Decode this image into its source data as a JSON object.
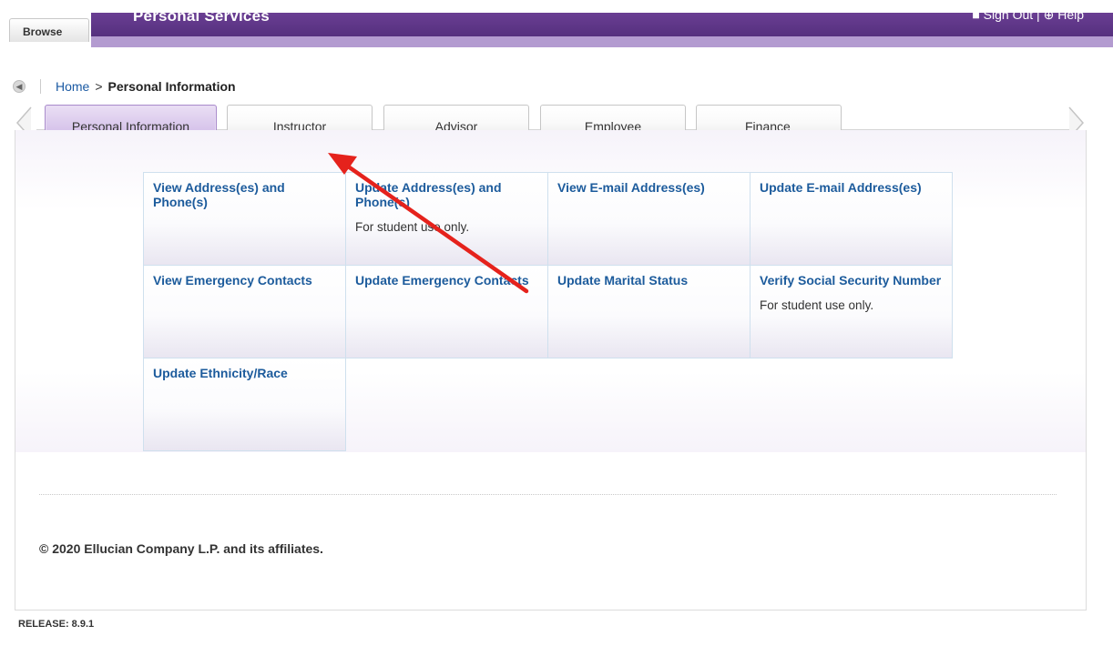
{
  "header": {
    "title": "Personal Services",
    "browse_label": "Browse",
    "sign_out_label": "Sign Out",
    "help_label": "Help",
    "divider": "|"
  },
  "breadcrumb": {
    "home": "Home",
    "separator": ">",
    "current": "Personal Information"
  },
  "tabs": [
    {
      "label": "Personal Information",
      "active": true
    },
    {
      "label": "Instructor",
      "active": false
    },
    {
      "label": "Advisor",
      "active": false
    },
    {
      "label": "Employee",
      "active": false
    },
    {
      "label": "Finance",
      "active": false
    }
  ],
  "menu": [
    {
      "label": "View Address(es) and Phone(s)",
      "note": ""
    },
    {
      "label": "Update Address(es) and Phone(s)",
      "note": "For student use only."
    },
    {
      "label": "View E-mail Address(es)",
      "note": ""
    },
    {
      "label": "Update E-mail Address(es)",
      "note": ""
    },
    {
      "label": "View Emergency Contacts",
      "note": ""
    },
    {
      "label": "Update Emergency Contacts",
      "note": ""
    },
    {
      "label": "Update Marital Status",
      "note": ""
    },
    {
      "label": "Verify Social Security Number",
      "note": "For student use only."
    },
    {
      "label": "Update Ethnicity/Race",
      "note": ""
    }
  ],
  "footer": {
    "copyright": "© 2020 Ellucian Company L.P. and its affiliates.",
    "release": "RELEASE: 8.9.1"
  },
  "colors": {
    "brand_purple": "#6a3e93",
    "link_blue": "#1c5b9c",
    "annotation_red": "#e5221c"
  },
  "icons": {
    "back": "left-arrow-circle-icon",
    "scroll_left": "chevron-left-icon",
    "scroll_right": "chevron-right-icon",
    "annotation": "red-arrow-annotation"
  }
}
